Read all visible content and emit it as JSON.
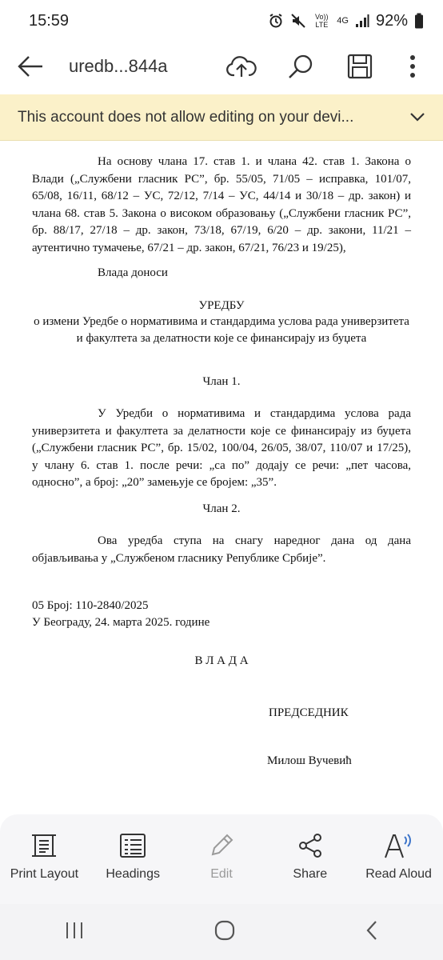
{
  "status": {
    "time": "15:59",
    "network": "4G",
    "volte": "Vo)) LTE",
    "battery": "92%"
  },
  "toolbar": {
    "title": "uredb...844a"
  },
  "banner": {
    "message": "This account does not allow editing on your devi..."
  },
  "document": {
    "intro": "На основу члана 17. став 1. и члана 42. став 1. Закона о Влади („Службени гласник РС”, бр. 55/05, 71/05 – исправка, 101/07, 65/08, 16/11, 68/12 – УС, 72/12, 7/14 – УС, 44/14 и 30/18 – др. закон) и члана 68. став 5. Закона о високом образовању („Службени гласник РС”, бр. 88/17, 27/18 – др. закон, 73/18, 67/19, 6/20 – др. закони, 11/21 – аутентично тумачење, 67/21 – др. закон, 67/21, 76/23 и 19/25),",
    "government_adopts": "Влада доноси",
    "decree_title": "УРЕДБУ",
    "decree_subtitle": "о измени Уредбе о нормативима и стандардима услова рада универзитета и факултета за делатности које се финансирају из буџета",
    "article1_heading": "Члан 1.",
    "article1_text": "У Уредби о нормативима и стандардима услова рада универзитета и факултета за делатности које се финансирају из буџета („Службени гласник РС”, бр. 15/02, 100/04, 26/05, 38/07, 110/07 и 17/25), у члану 6. став 1. после речи: „са по” додају се речи: „пет часова, односно”, а број: „20” замењује се бројем: „35”.",
    "article2_heading": "Члан 2.",
    "article2_text": "Ова уредба ступа на снагу наредног дана од дана објављивања у „Службеном гласнику Републике Србије”.",
    "number": "05 Број: 110-2840/2025",
    "place_date": "У Београду, 24. марта 2025. године",
    "government": "В Л А Д А",
    "president_title": "ПРЕДСЕДНИК",
    "president_name": "Милош Вучевић"
  },
  "bottom_tools": [
    {
      "label": "Print Layout",
      "icon": "print-layout-icon"
    },
    {
      "label": "Headings",
      "icon": "headings-icon"
    },
    {
      "label": "Edit",
      "icon": "pencil-icon"
    },
    {
      "label": "Share",
      "icon": "share-icon"
    },
    {
      "label": "Read Aloud",
      "icon": "read-aloud-icon"
    }
  ]
}
